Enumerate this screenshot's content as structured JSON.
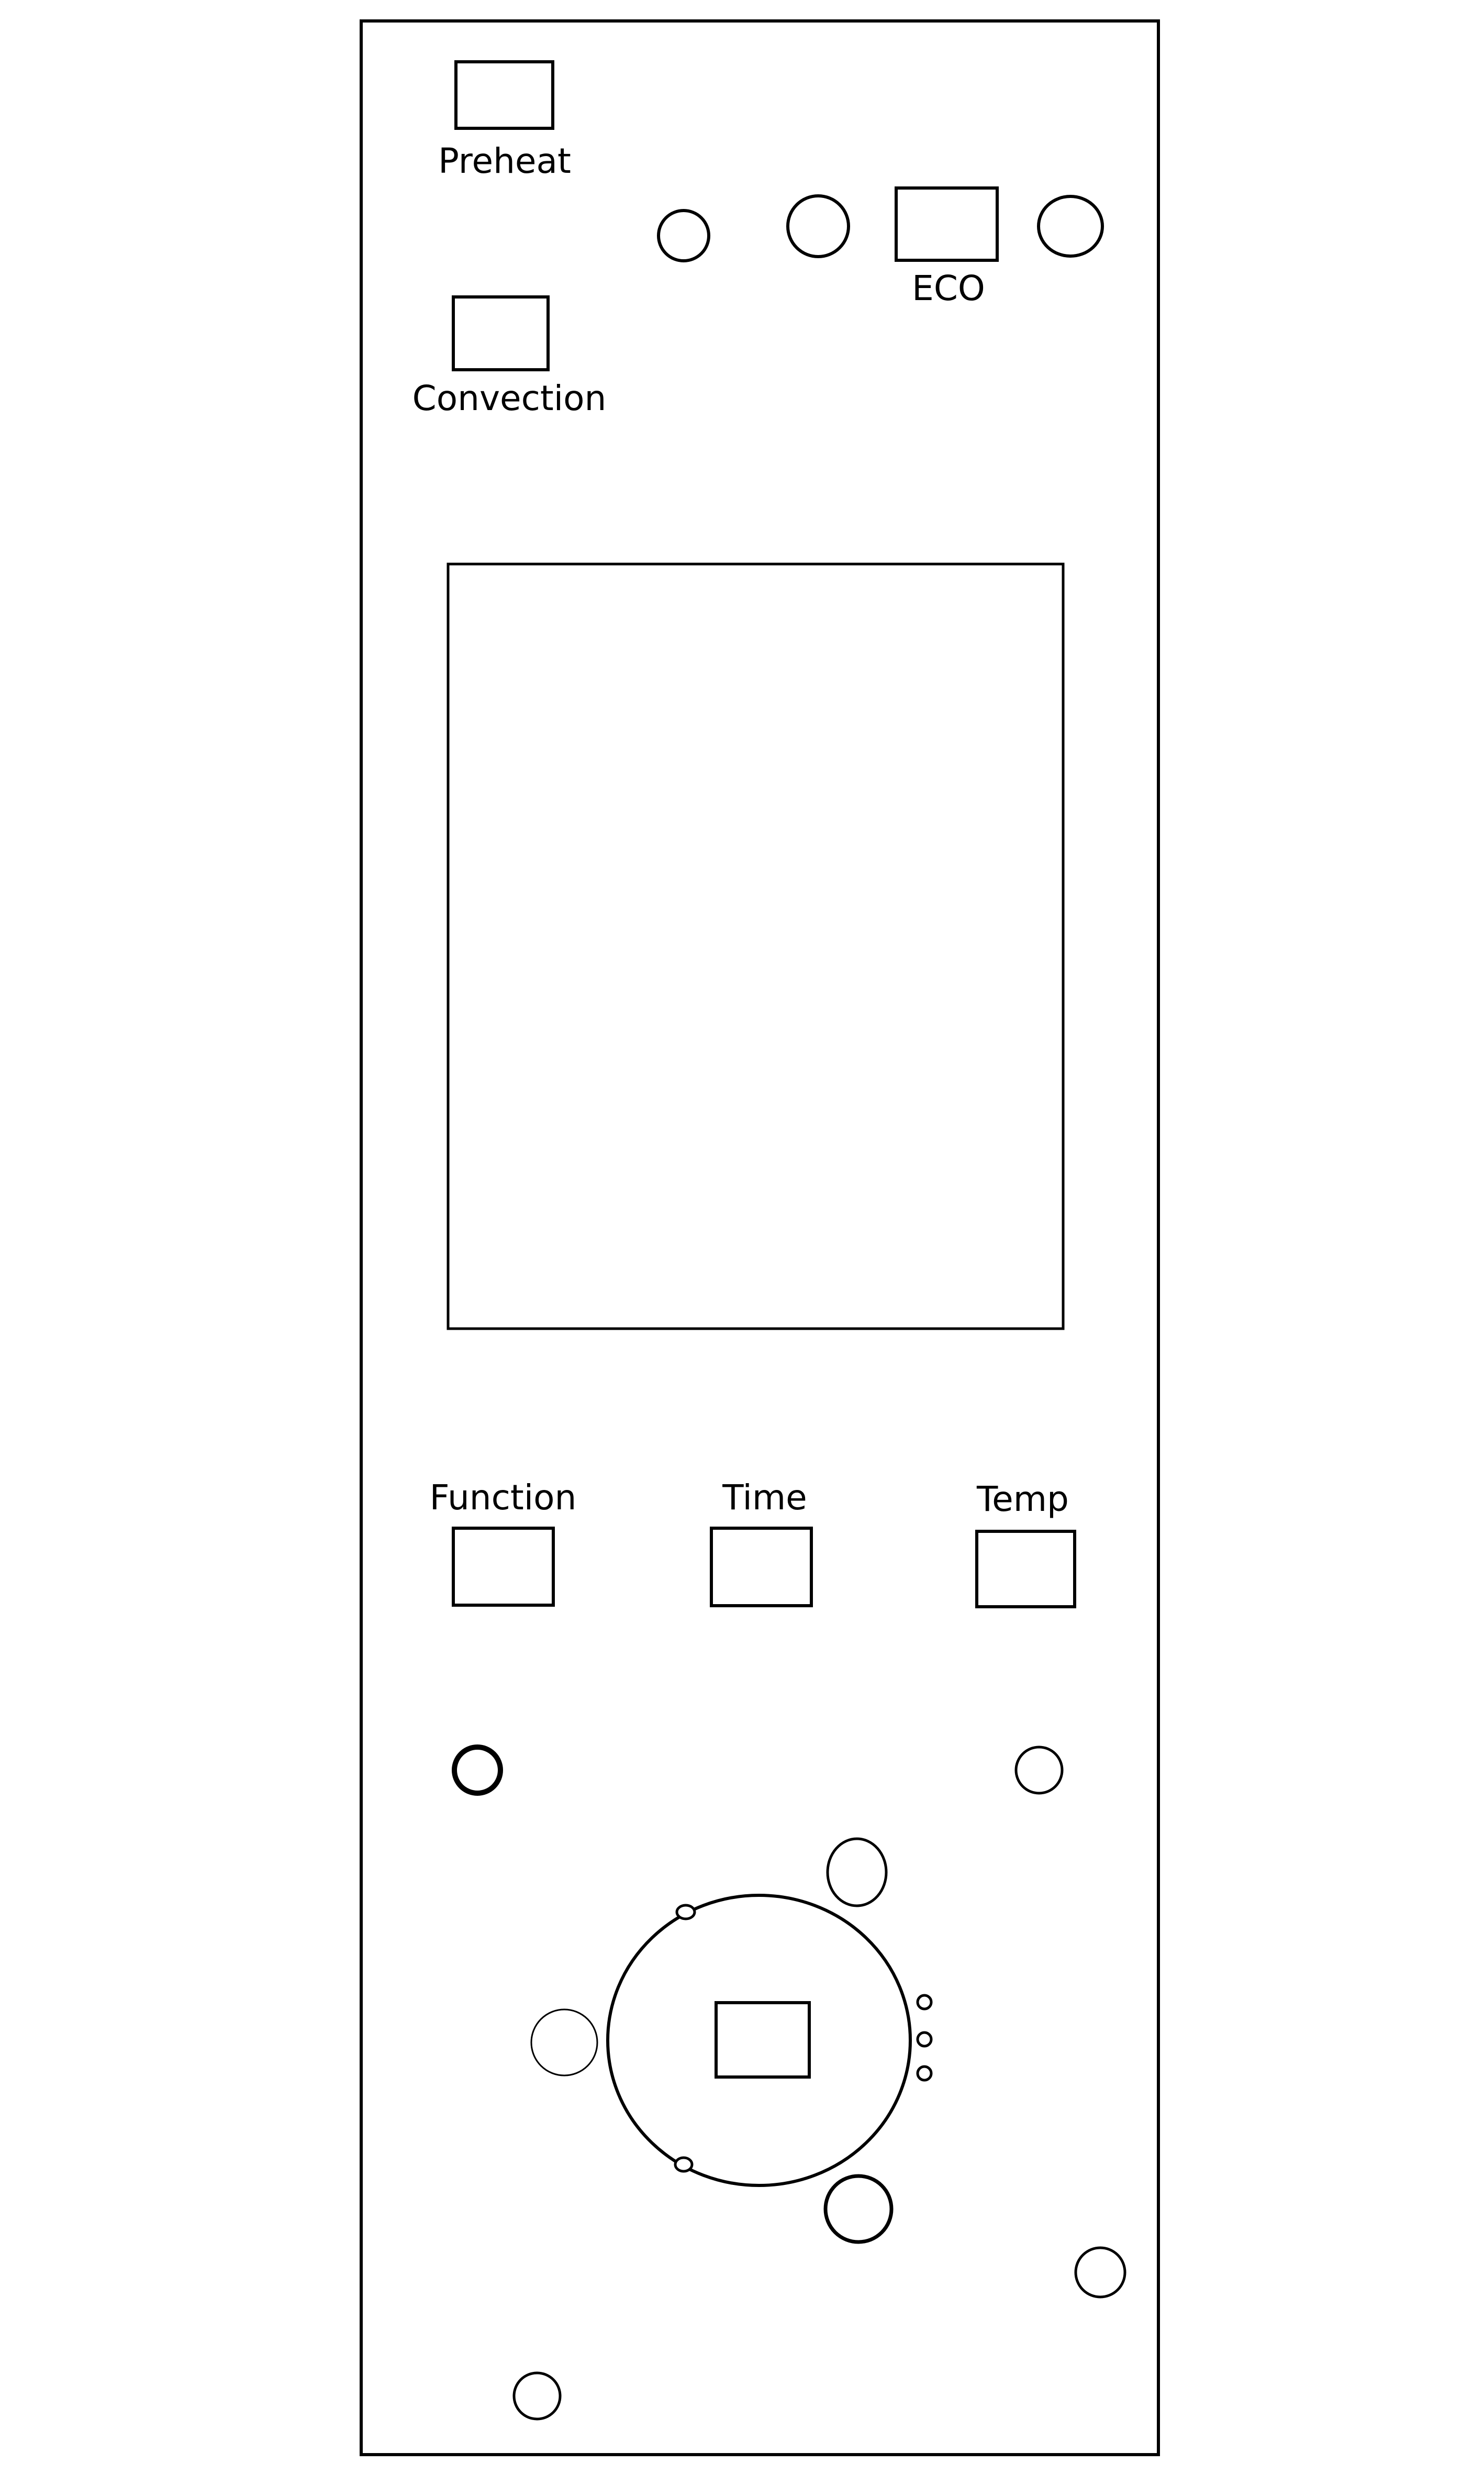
{
  "panel": {
    "buttons": {
      "preheat": "Preheat",
      "convection": "Convection",
      "eco": "ECO",
      "function": "Function",
      "time": "Time",
      "temp": "Temp"
    }
  },
  "colors": {
    "stroke": "#000000",
    "background": "#ffffff"
  }
}
